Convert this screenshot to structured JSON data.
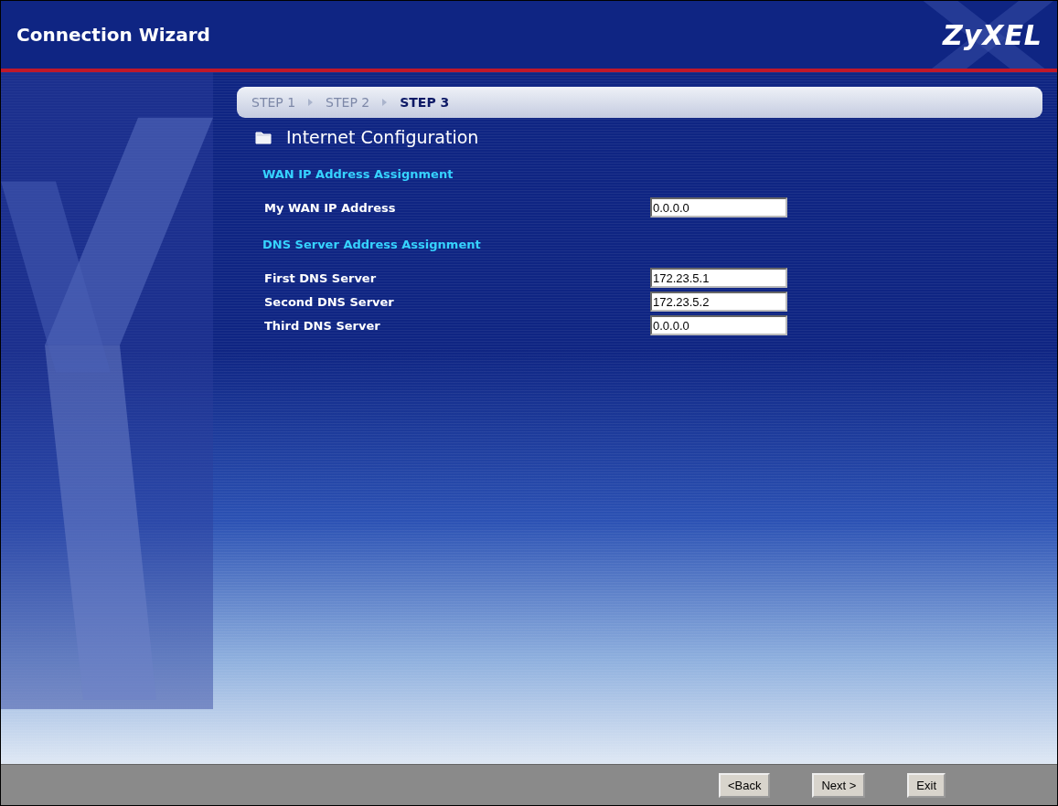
{
  "window": {
    "title": "Connection Wizard",
    "logo": "ZyXEL"
  },
  "steps": [
    {
      "label": "STEP 1",
      "selected": false
    },
    {
      "label": "STEP 2",
      "selected": false
    },
    {
      "label": "STEP 3",
      "selected": true
    }
  ],
  "page_title": "Internet Configuration",
  "sections": [
    {
      "heading": "WAN IP Address Assignment",
      "fields": [
        {
          "label": "My WAN IP Address",
          "value": "0.0.0.0"
        }
      ]
    },
    {
      "heading": "DNS Server Address Assignment",
      "fields": [
        {
          "label": "First DNS Server",
          "value": "172.23.5.1"
        },
        {
          "label": "Second DNS Server",
          "value": "172.23.5.2"
        },
        {
          "label": "Third DNS Server",
          "value": "0.0.0.0"
        }
      ]
    }
  ],
  "buttons": [
    "<Back",
    "Next >",
    "Exit"
  ]
}
